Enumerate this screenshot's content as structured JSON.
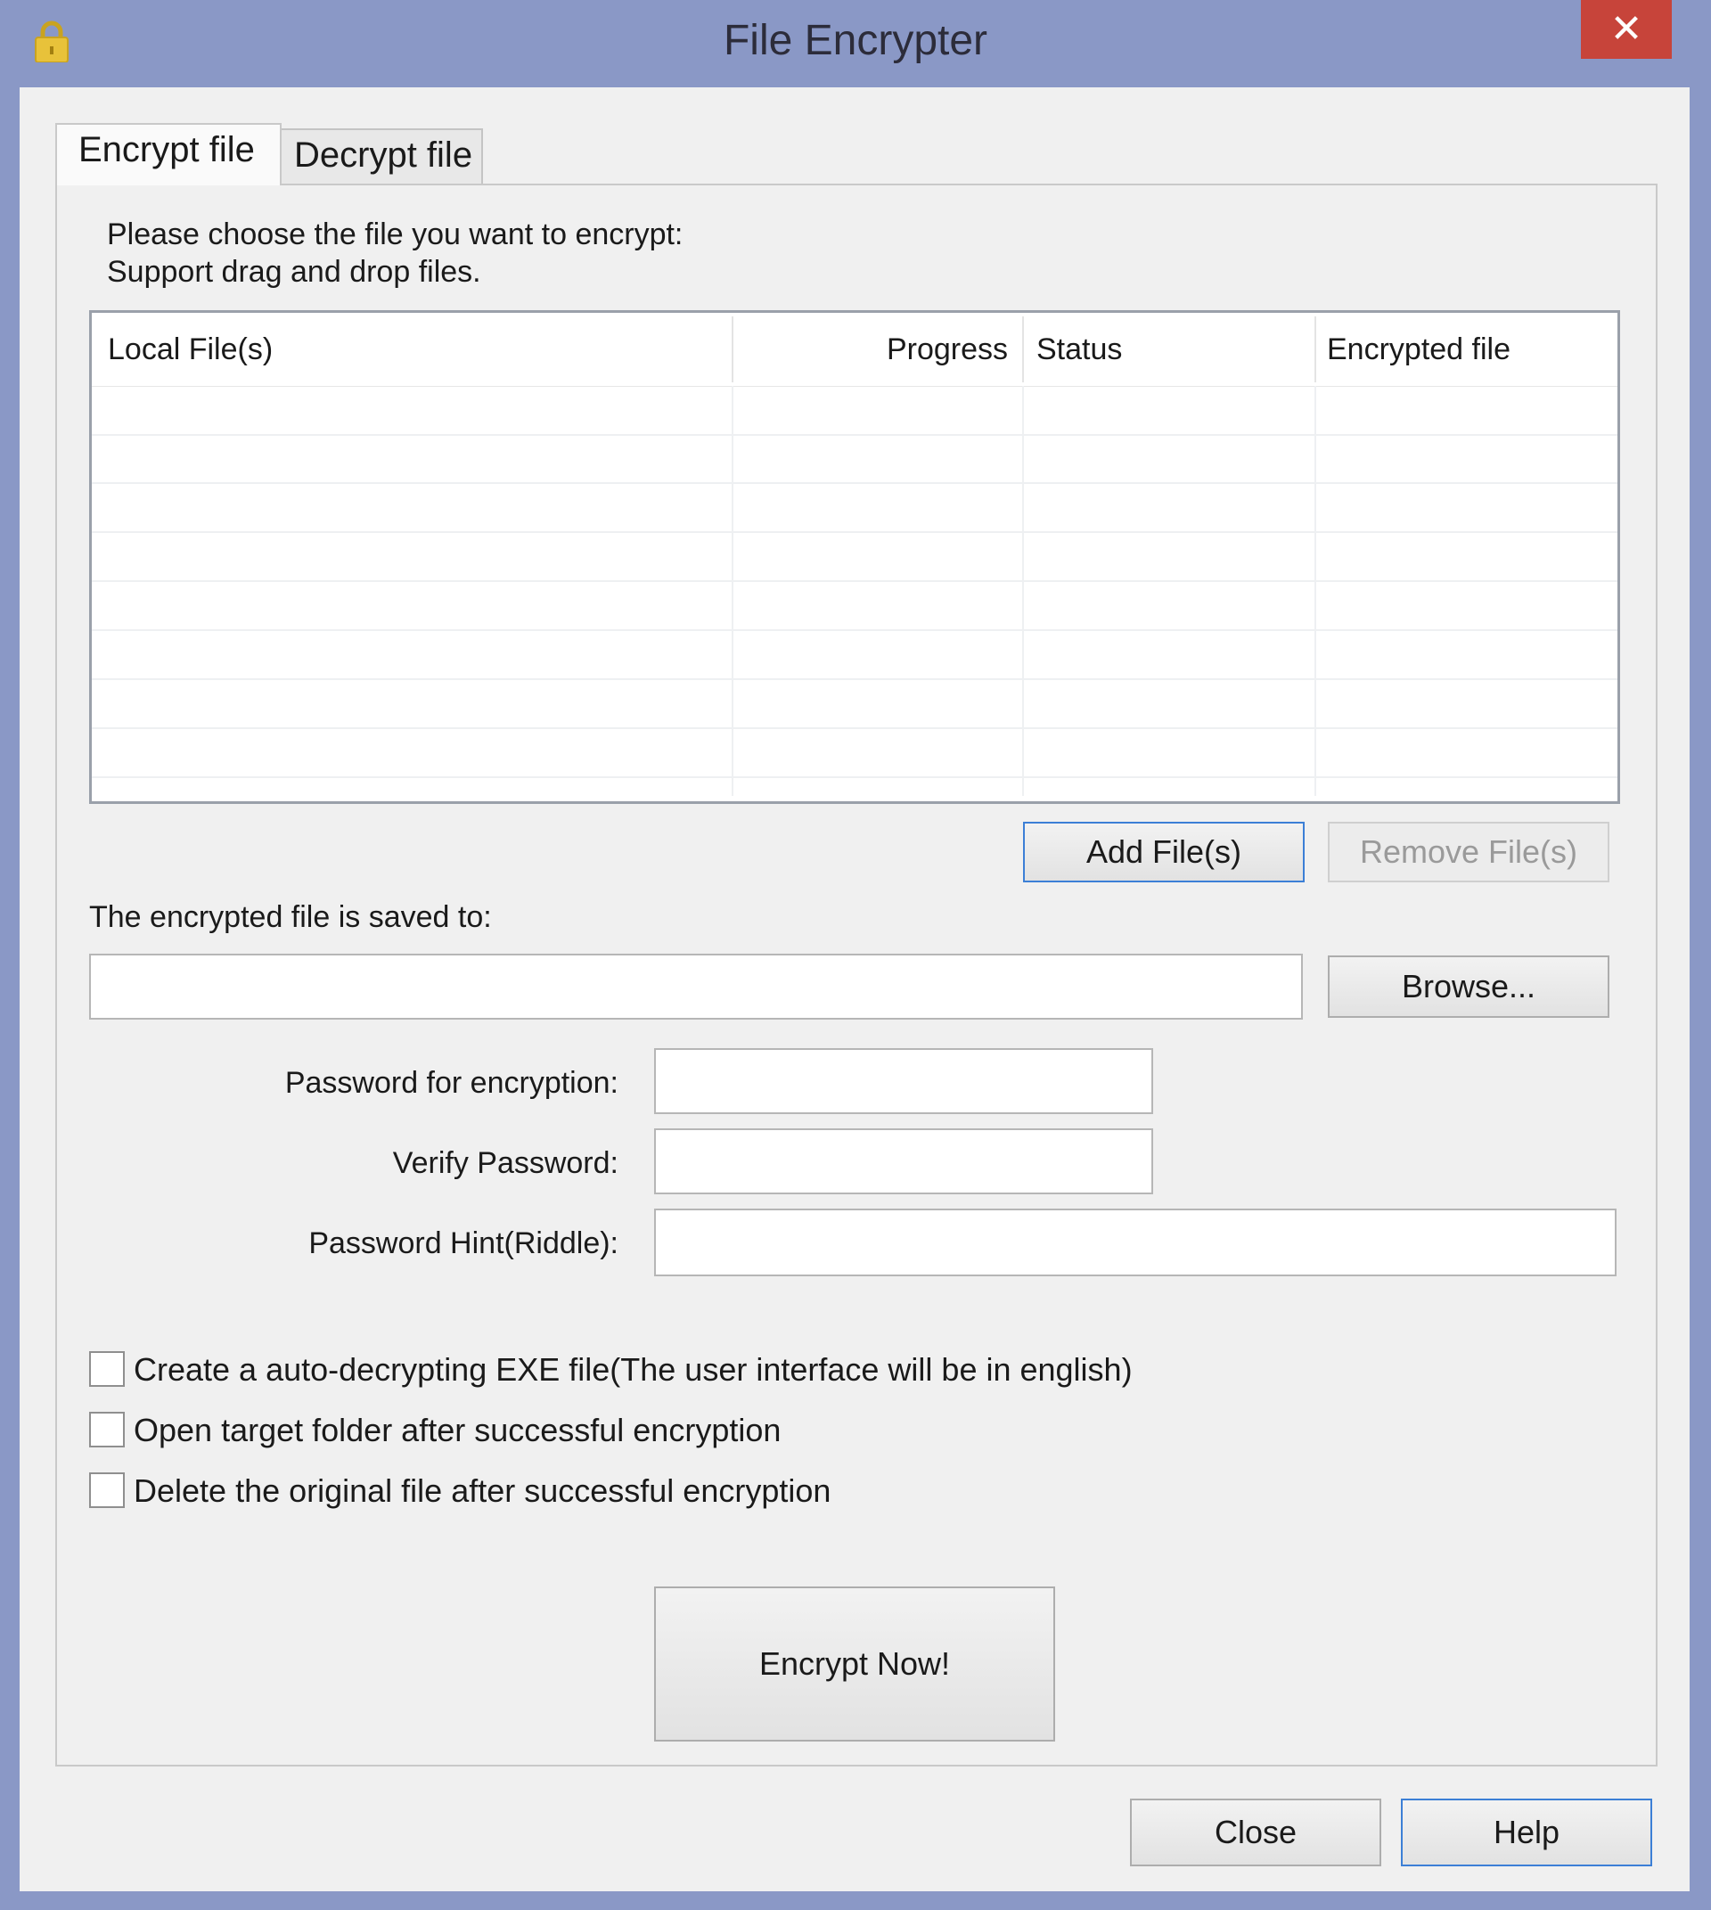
{
  "window": {
    "title": "File Encrypter",
    "close_glyph": "✕",
    "icon": "lock-icon"
  },
  "tabs": [
    {
      "label": "Encrypt file",
      "active": true
    },
    {
      "label": "Decrypt file",
      "active": false
    }
  ],
  "instructions": {
    "line1": "Please choose the file you want to encrypt:",
    "line2": "Support drag and drop files."
  },
  "file_table": {
    "columns": [
      "Local File(s)",
      "Progress",
      "Status",
      "Encrypted file"
    ],
    "rows": []
  },
  "buttons": {
    "add_files": "Add File(s)",
    "remove_files": "Remove File(s)",
    "browse": "Browse...",
    "encrypt_now": "Encrypt Now!",
    "close": "Close",
    "help": "Help"
  },
  "save_to": {
    "label": "The encrypted file is saved to:",
    "value": ""
  },
  "password": {
    "label": "Password for encryption:",
    "verify_label": "Verify Password:",
    "hint_label": "Password Hint(Riddle):"
  },
  "options": [
    {
      "label": "Create a auto-decrypting EXE file(The user interface will be in english)",
      "checked": false
    },
    {
      "label": "Open target folder after successful encryption",
      "checked": false
    },
    {
      "label": "Delete the original file after successful encryption",
      "checked": false
    }
  ],
  "colors": {
    "frame": "#8a98c6",
    "close_button": "#c7443a",
    "focus_border": "#3c7fd6",
    "lock_icon": "#e8c23a"
  }
}
